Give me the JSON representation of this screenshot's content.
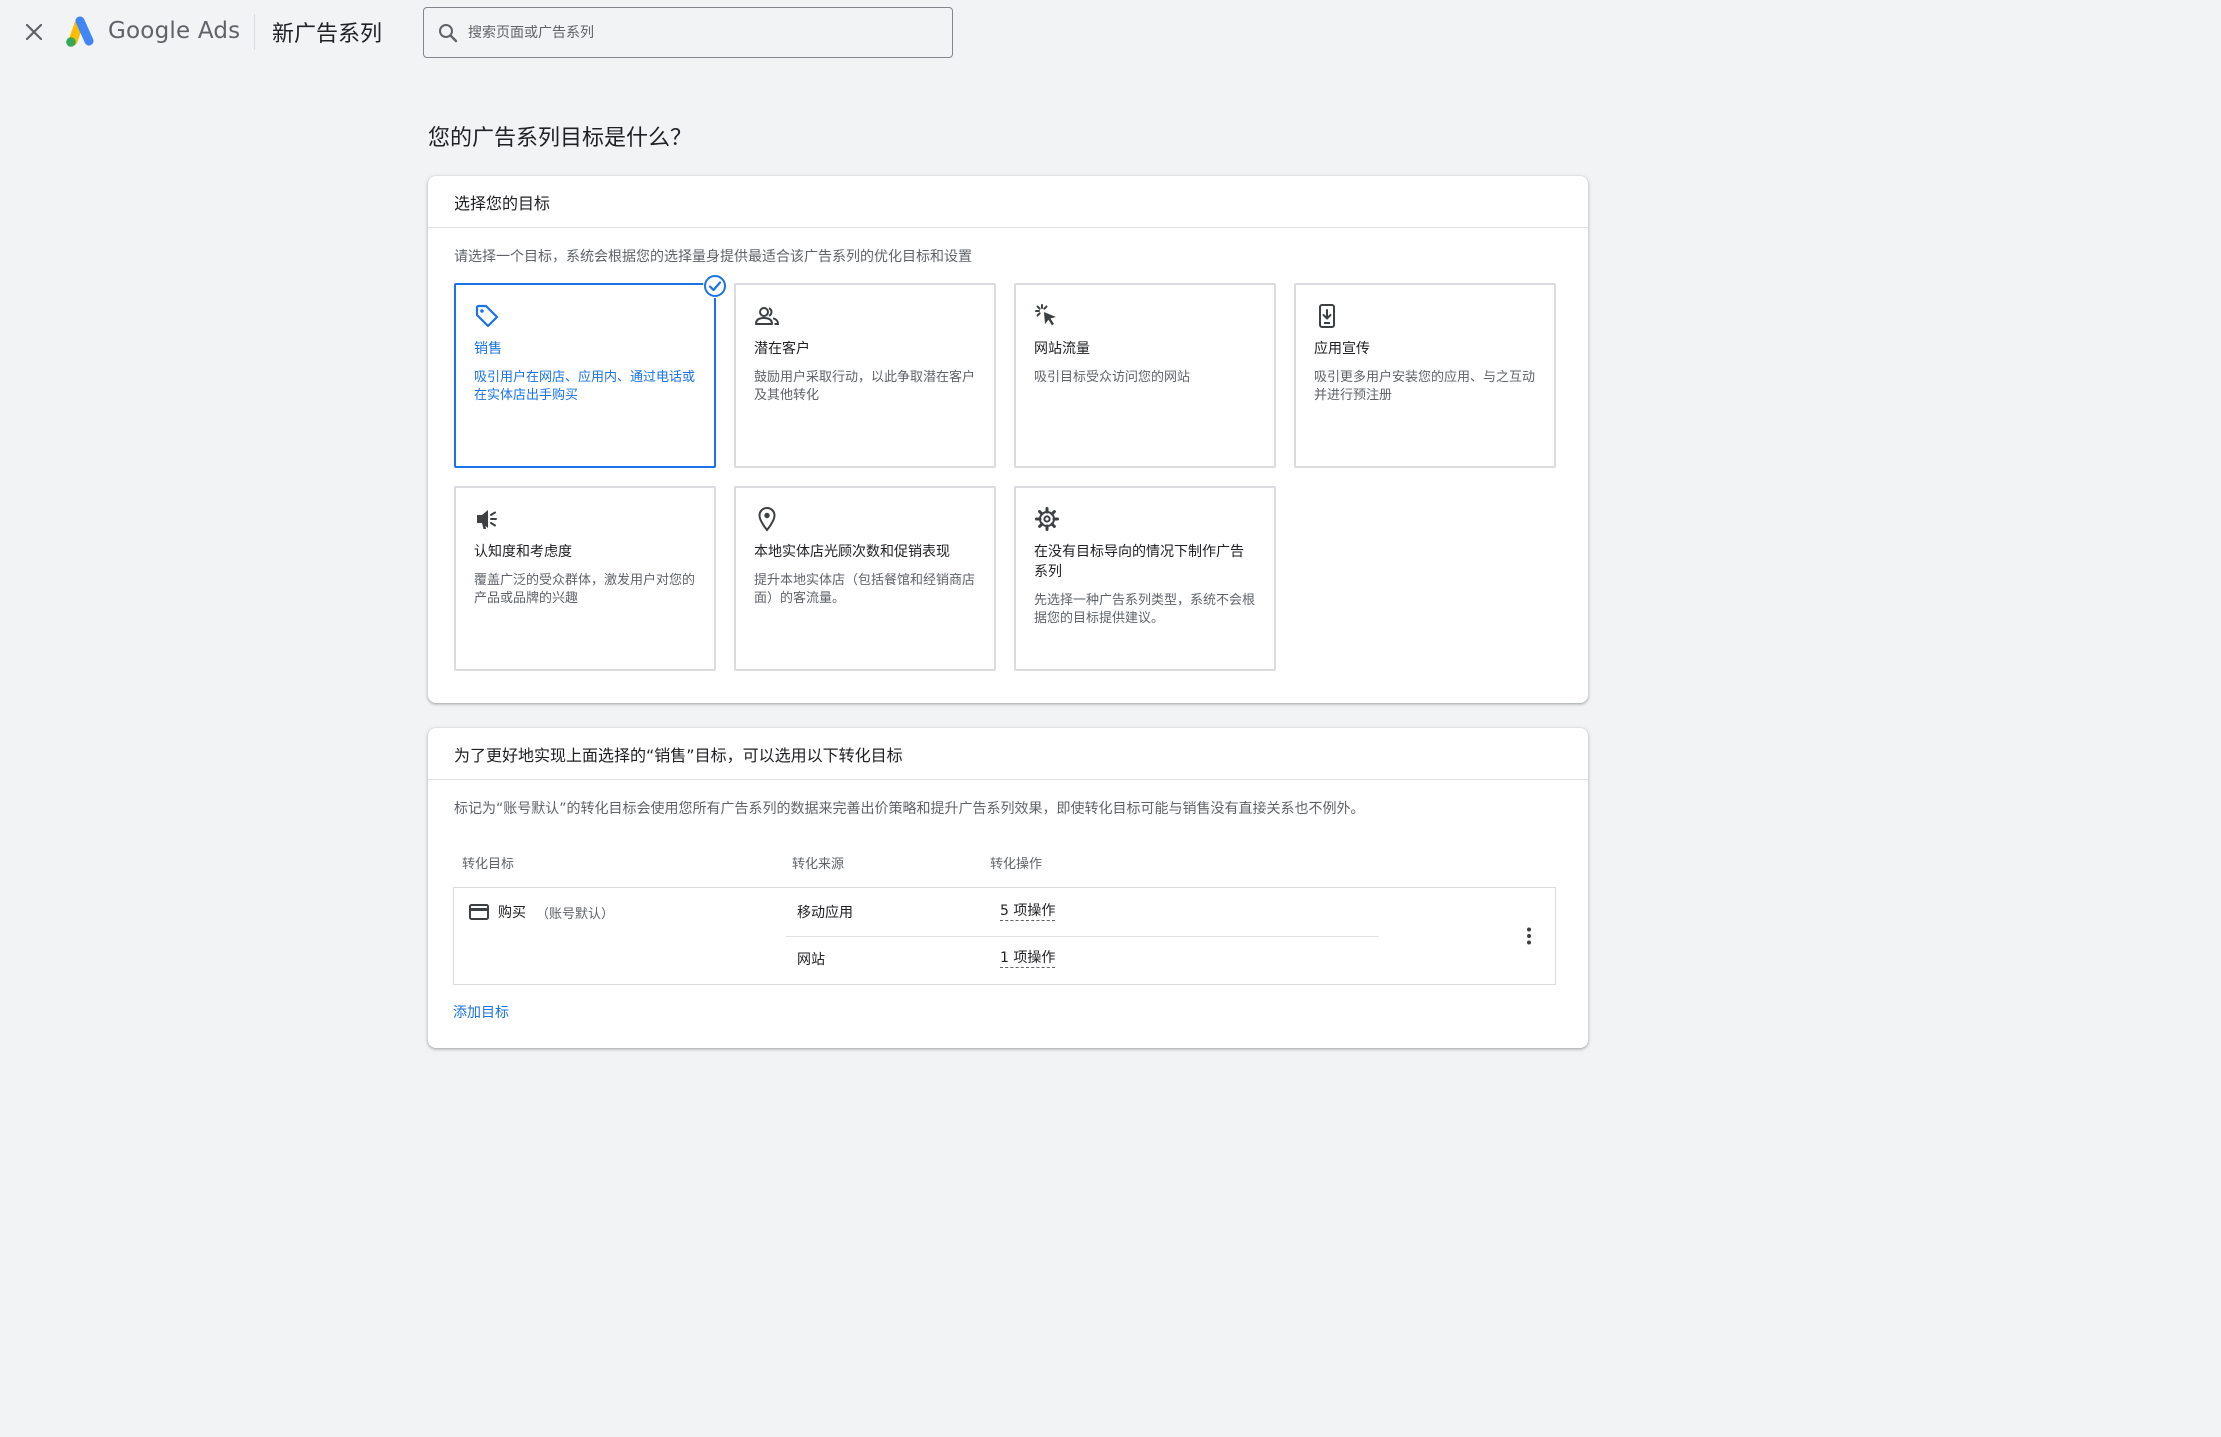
{
  "header": {
    "logo_text": "Google Ads",
    "page_title": "新广告系列",
    "search_placeholder": "搜索页面或广告系列"
  },
  "question": "您的广告系列目标是什么？",
  "goal_card": {
    "title": "选择您的目标",
    "description": "请选择一个目标，系统会根据您的选择量身提供最适合该广告系列的优化目标和设置",
    "selected": "sales",
    "goals": [
      {
        "id": "sales",
        "icon": "tag-icon",
        "title": "销售",
        "description": "吸引用户在网店、应用内、通过电话或在实体店出手购买"
      },
      {
        "id": "leads",
        "icon": "people-icon",
        "title": "潜在客户",
        "description": "鼓励用户采取行动，以此争取潜在客户及其他转化"
      },
      {
        "id": "website-traffic",
        "icon": "cursor-click-icon",
        "title": "网站流量",
        "description": "吸引目标受众访问您的网站"
      },
      {
        "id": "app-promotion",
        "icon": "phone-download-icon",
        "title": "应用宣传",
        "description": "吸引更多用户安装您的应用、与之互动并进行预注册"
      },
      {
        "id": "awareness",
        "icon": "megaphone-icon",
        "title": "认知度和考虑度",
        "description": "覆盖广泛的受众群体，激发用户对您的产品或品牌的兴趣"
      },
      {
        "id": "local-store",
        "icon": "location-pin-icon",
        "title": "本地实体店光顾次数和促销表现",
        "description": "提升本地实体店（包括餐馆和经销商店面）的客流量。"
      },
      {
        "id": "no-goal",
        "icon": "gear-icon",
        "title": "在没有目标导向的情况下制作广告系列",
        "description": "先选择一种广告系列类型，系统不会根据您的目标提供建议。"
      }
    ]
  },
  "conversion_card": {
    "title": "为了更好地实现上面选择的“销售”目标，可以选用以下转化目标",
    "description": "标记为“账号默认”的转化目标会使用您所有广告系列的数据来完善出价策略和提升广告系列效果，即使转化目标可能与销售没有直接关系也不例外。",
    "columns": [
      "转化目标",
      "转化来源",
      "转化操作"
    ],
    "rows": [
      {
        "name": "购买",
        "tag": "（账号默认）",
        "icon": "credit-card-icon",
        "sources": [
          {
            "source": "移动应用",
            "actions": "5 项操作"
          },
          {
            "source": "网站",
            "actions": "1 项操作"
          }
        ]
      }
    ],
    "add_link": "添加目标"
  },
  "colors": {
    "accent": "#1a73e8",
    "background": "#f1f3f4",
    "border": "#dadce0",
    "text_secondary": "#5f6368"
  }
}
